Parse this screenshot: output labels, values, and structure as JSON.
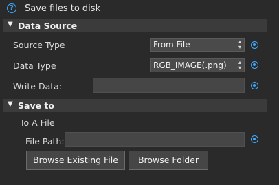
{
  "window": {
    "title": "Save files to disk",
    "help_icon": "?"
  },
  "data_source": {
    "header": "Data Source",
    "collapse_icon": "▼",
    "source_type_label": "Source Type",
    "source_type_value": "From File",
    "data_type_label": "Data Type",
    "data_type_value": "RGB_IMAGE(.png)",
    "write_data_label": "Write Data:",
    "write_data_value": ""
  },
  "save_to": {
    "header": "Save to",
    "collapse_icon": "▼",
    "to_a_file_label": "To A File",
    "file_path_label": "File Path:",
    "file_path_value": "",
    "browse_file_button": "Browse Existing File",
    "browse_folder_button": "Browse Folder"
  },
  "icons": {
    "combo_arrows": "▴\n▾",
    "accent_color": "#3da9ff"
  }
}
